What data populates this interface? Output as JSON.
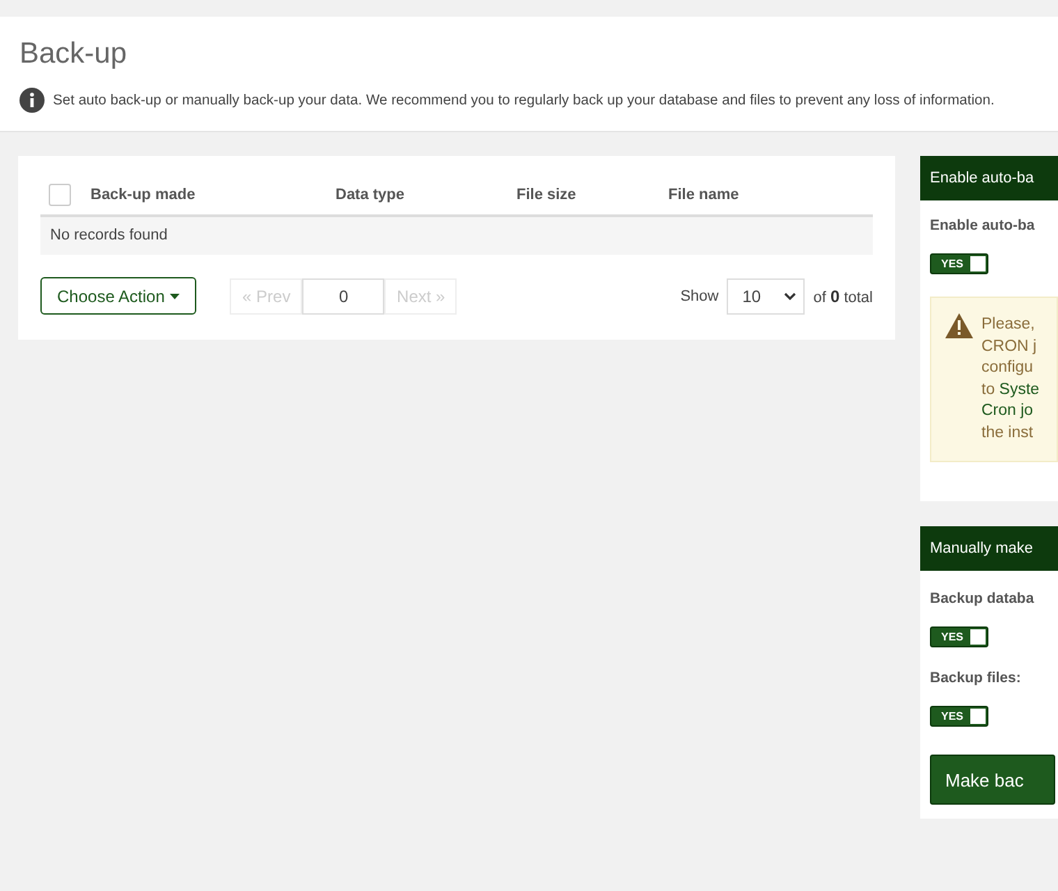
{
  "page": {
    "title": "Back-up",
    "description": "Set auto back-up or manually back-up your data. We recommend you to regularly back up your database and files to prevent any loss of information."
  },
  "table": {
    "select_all": {
      "checked": false
    },
    "columns": [
      "Back-up made",
      "Data type",
      "File size",
      "File name"
    ],
    "empty_message": "No records found"
  },
  "toolbar": {
    "action_button": "Choose Action",
    "prev": "« Prev",
    "page": "0",
    "next": "Next »",
    "show_label": "Show",
    "page_size": "10",
    "total_prefix": "of",
    "total": "0",
    "total_suffix": "total"
  },
  "auto_panel": {
    "title": "Enable auto-ba",
    "field_label": "Enable auto-ba",
    "toggle": {
      "on": true,
      "label": "YES"
    },
    "warning": [
      {
        "parts": [
          {
            "text": "Please,",
            "link": false
          }
        ]
      },
      {
        "parts": [
          {
            "text": "CRON j",
            "link": false
          }
        ]
      },
      {
        "parts": [
          {
            "text": "configu",
            "link": false
          }
        ]
      },
      {
        "parts": [
          {
            "text": "to ",
            "link": false
          },
          {
            "text": "Syste",
            "link": true
          }
        ]
      },
      {
        "parts": [
          {
            "text": "Cron jo",
            "link": true
          }
        ]
      },
      {
        "parts": [
          {
            "text": "the inst",
            "link": false
          }
        ]
      }
    ]
  },
  "manual_panel": {
    "title": "Manually make",
    "fields": [
      {
        "label": "Backup databa",
        "toggle": {
          "on": true,
          "label": "YES"
        }
      },
      {
        "label": "Backup files:",
        "toggle": {
          "on": true,
          "label": "YES"
        }
      }
    ],
    "button": "Make bac"
  }
}
